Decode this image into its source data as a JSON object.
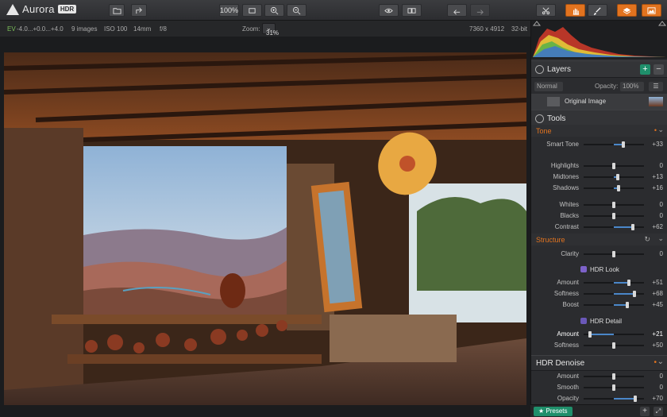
{
  "app": {
    "name": "Aurora",
    "badge": "HDR"
  },
  "toolbar": {
    "zoom_percent": "100%"
  },
  "infobar": {
    "ev": "EV",
    "ev_values": "-4.0...+0.0...+4.0",
    "images": "9 images",
    "iso": "ISO 100",
    "focal": "14mm",
    "aperture": "f/8",
    "zoom_label": "Zoom:",
    "zoom_value": "31%",
    "dimensions": "7360 x 4912",
    "bitdepth": "32-bit"
  },
  "layers": {
    "title": "Layers",
    "blend": "Normal",
    "opacity_label": "Opacity:",
    "opacity_value": "100%",
    "layer_name": "Original Image"
  },
  "tools": {
    "title": "Tools",
    "tone": {
      "title": "Tone",
      "rows": [
        {
          "label": "Smart Tone",
          "value": "+33",
          "level": 0.66
        },
        {
          "label": "Highlights",
          "value": "0",
          "level": 0.5
        },
        {
          "label": "Midtones",
          "value": "+13",
          "level": 0.565
        },
        {
          "label": "Shadows",
          "value": "+16",
          "level": 0.58
        },
        {
          "label": "Whites",
          "value": "0",
          "level": 0.5
        },
        {
          "label": "Blacks",
          "value": "0",
          "level": 0.5
        },
        {
          "label": "Contrast",
          "value": "+62",
          "level": 0.81
        }
      ]
    },
    "structure": {
      "title": "Structure",
      "clarity": {
        "label": "Clarity",
        "value": "0",
        "level": 0.5
      },
      "hdr_look": {
        "title": "HDR Look",
        "rows": [
          {
            "label": "Amount",
            "value": "+51",
            "level": 0.755
          },
          {
            "label": "Softness",
            "value": "+68",
            "level": 0.84
          },
          {
            "label": "Boost",
            "value": "+45",
            "level": 0.725
          }
        ]
      },
      "hdr_detail": {
        "title": "HDR Detail",
        "rows": [
          {
            "label": "Amount",
            "value": "+21",
            "level": 0.105
          },
          {
            "label": "Softness",
            "value": "+50",
            "level": 0.5
          }
        ]
      }
    },
    "denoise": {
      "title": "HDR Denoise",
      "rows": [
        {
          "label": "Amount",
          "value": "0",
          "level": 0.5
        },
        {
          "label": "Smooth",
          "value": "0",
          "level": 0.5
        },
        {
          "label": "Opacity",
          "value": "+70",
          "level": 0.85
        }
      ]
    }
  },
  "bottom": {
    "presets": "Presets"
  },
  "colors": {
    "accent": "#e2731f",
    "slider": "#4a87c9",
    "presets": "#1f8f6b"
  }
}
